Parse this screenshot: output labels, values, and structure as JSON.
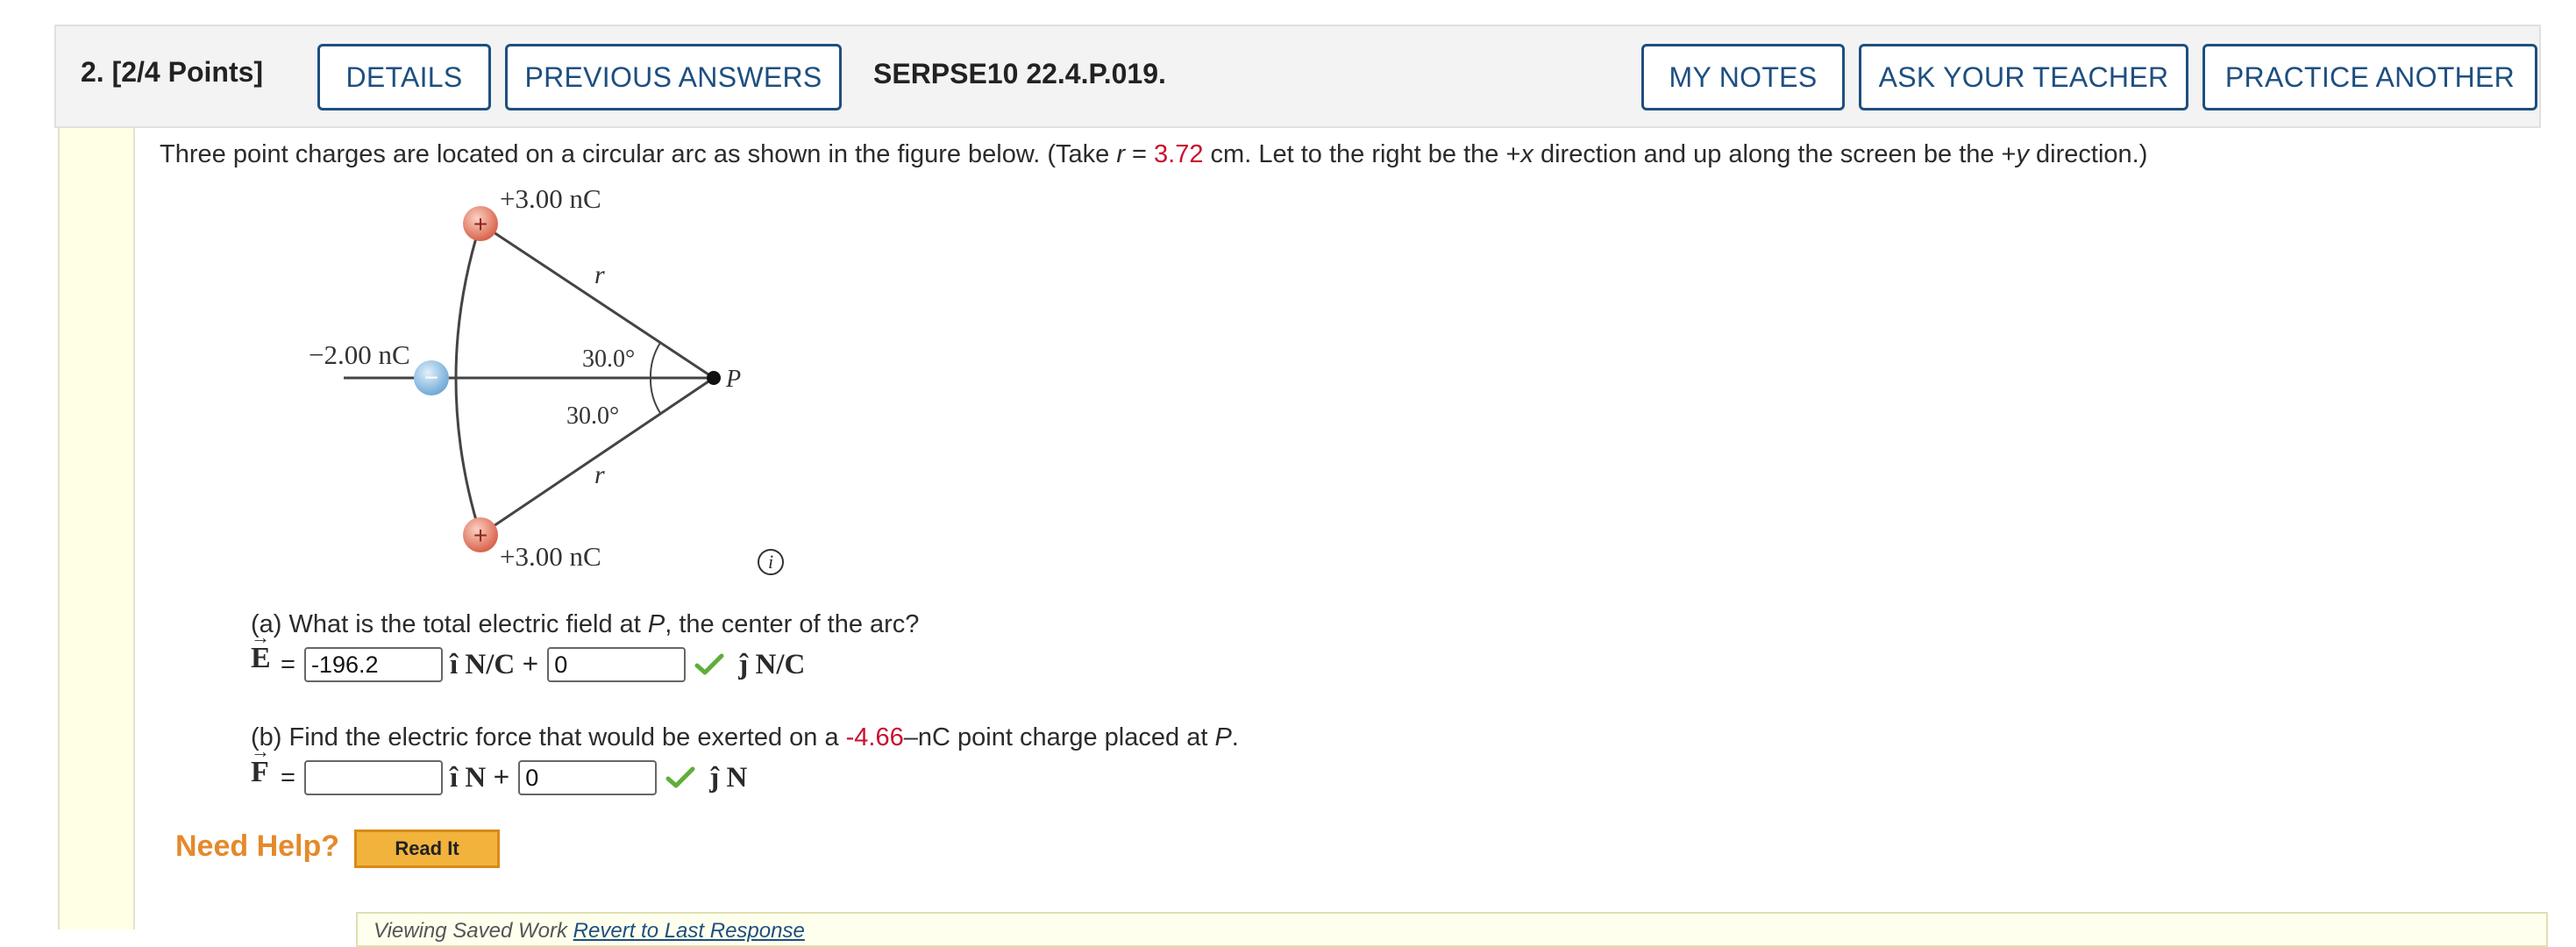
{
  "header": {
    "question_label": "2.  [2/4 Points]",
    "details_button": "DETAILS",
    "previous_answers_button": "PREVIOUS ANSWERS",
    "problem_code": "SERPSE10 22.4.P.019.",
    "my_notes_button": "MY NOTES",
    "ask_teacher_button": "ASK YOUR TEACHER",
    "practice_another_button": "PRACTICE ANOTHER"
  },
  "problem": {
    "intro_part1": "Three point charges are located on a circular arc as shown in the figure below. (Take ",
    "r_var": "r",
    "eq": " = ",
    "r_value": "3.72",
    "intro_part2": " cm. Let to the right be the +",
    "x_var": "x",
    "intro_part3": " direction and up along the screen be the +",
    "y_var": "y",
    "intro_part4": " direction.)"
  },
  "figure": {
    "top_charge_label": "+3.00 nC",
    "middle_charge_label": "−2.00 nC",
    "bottom_charge_label": "+3.00 nC",
    "r_label_top": "r",
    "r_label_bottom": "r",
    "angle_top": "30.0°",
    "angle_bottom": "30.0°",
    "point_label": "P",
    "info_glyph": "i",
    "charge_colors": {
      "positive": "#e8806a",
      "negative": "#8fc3e8"
    }
  },
  "part_a": {
    "q_prefix": "(a) What is the total electric field at ",
    "q_var": "P",
    "q_suffix": ", the center of the arc?",
    "vector_symbol": "E",
    "equals": "=",
    "i_value": "-196.2",
    "i_unit": "î N/C +",
    "j_value": "0",
    "j_unit": "ĵ N/C"
  },
  "part_b": {
    "q_prefix": "(b) Find the electric force that would be exerted on a ",
    "charge_value": "-4.66",
    "q_mid": "–nC point charge placed at ",
    "q_var": "P",
    "q_suffix": ".",
    "vector_symbol": "F",
    "equals": "=",
    "i_value": "",
    "i_unit": "î N +",
    "j_value": "0",
    "j_unit": "ĵ N"
  },
  "help": {
    "need_help": "Need Help?",
    "read_it_button": "Read It"
  },
  "saved_work": {
    "viewing_text": "Viewing Saved Work ",
    "revert_link": "Revert to Last Response"
  }
}
